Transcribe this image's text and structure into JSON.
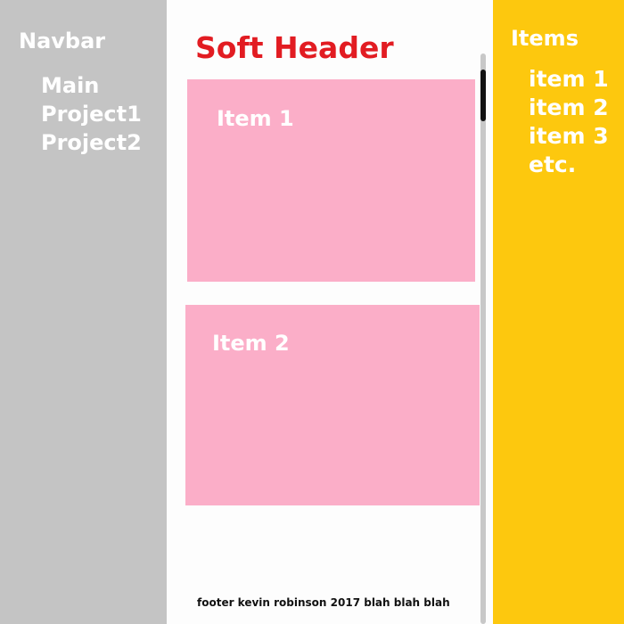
{
  "navbar": {
    "title": "Navbar",
    "links": [
      "Main",
      "Project1",
      "Project2"
    ]
  },
  "main": {
    "header": "Soft Header",
    "cards": [
      {
        "title": "Item 1"
      },
      {
        "title": "Item 2"
      }
    ],
    "footer": "footer kevin robinson 2017 blah blah blah"
  },
  "items_panel": {
    "title": "Items",
    "items": [
      "item 1",
      "item 2",
      "item 3",
      "etc."
    ]
  },
  "colors": {
    "navbar_bg": "#c4c4c4",
    "header_text": "#e21c22",
    "card_bg": "#fbaec8",
    "items_panel_bg": "#fdc80e"
  }
}
